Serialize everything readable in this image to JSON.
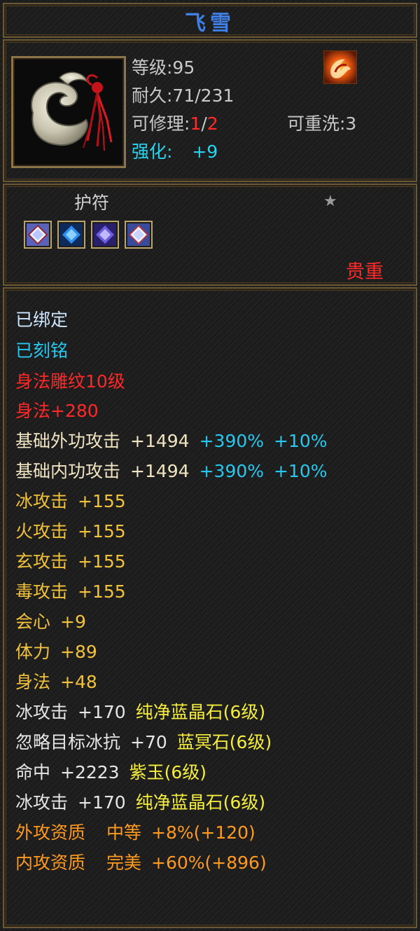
{
  "item": {
    "name": "飞雪",
    "level": "等级:95",
    "durability": "耐久:71/231",
    "repair_label": "可修理:",
    "repair_current": "1",
    "repair_sep": "/",
    "repair_max": "2",
    "rewash": "可重洗:3",
    "enhance_label": "强化:",
    "enhance_value": "+9",
    "type": "护符",
    "rarity": "贵重",
    "icons": {
      "portrait": "jade-talisman-icon",
      "skill": "flame-skill-icon",
      "star": "star-icon",
      "gems": [
        "white-gem-icon",
        "blue-gem-icon",
        "purple-gem-icon",
        "white-gem-icon"
      ]
    }
  },
  "stats": [
    {
      "text": "已绑定",
      "color": "#cfe6ff"
    },
    {
      "text": "已刻铭",
      "color": "#26c8f0"
    },
    {
      "text": "身法雕纹10级",
      "color": "#ff2828"
    },
    {
      "text": "身法+280",
      "color": "#ff2828"
    }
  ],
  "attack_lines": [
    {
      "label": "基础外功攻击",
      "value": "+1494",
      "pct1": "+390%",
      "pct2": "+10%"
    },
    {
      "label": "基础内功攻击",
      "value": "+1494",
      "pct1": "+390%",
      "pct2": "+10%"
    }
  ],
  "gold_lines": [
    {
      "label": "冰攻击",
      "value": "+155"
    },
    {
      "label": "火攻击",
      "value": "+155"
    },
    {
      "label": "玄攻击",
      "value": "+155"
    },
    {
      "label": "毒攻击",
      "value": "+155"
    },
    {
      "label": "会心",
      "value": "+9"
    },
    {
      "label": "体力",
      "value": "+89"
    },
    {
      "label": "身法",
      "value": "+48"
    }
  ],
  "gem_lines": [
    {
      "label": "冰攻击",
      "value": "+170",
      "gem": "纯净蓝晶石(6级)"
    },
    {
      "label": "忽略目标冰抗",
      "value": "+70",
      "gem": "蓝冥石(6级)"
    },
    {
      "label": "命中",
      "value": "+2223",
      "gem": "紫玉(6级)"
    },
    {
      "label": "冰攻击",
      "value": "+170",
      "gem": "纯净蓝晶石(6级)"
    }
  ],
  "quality_lines": [
    {
      "label": "外攻资质",
      "grade": "中等",
      "bonus": "+8%(+120)"
    },
    {
      "label": "内攻资质",
      "grade": "完美",
      "bonus": "+60%(+896)"
    }
  ],
  "colors": {
    "title": "#3f7fe6",
    "border": "#6b5836",
    "gold": "#f2c23a",
    "yellow": "#f6ee3c",
    "orange": "#ff9a1f",
    "cyan": "#26c8f0",
    "red": "#ff2828"
  }
}
